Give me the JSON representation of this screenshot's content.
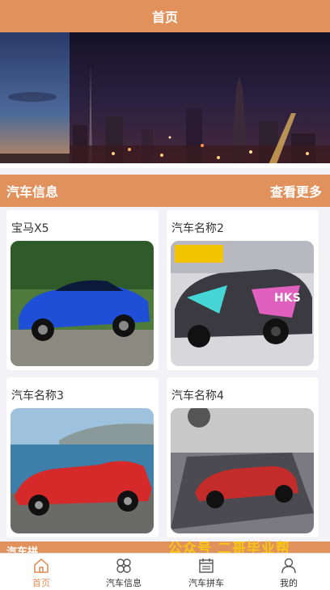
{
  "navbar": {
    "title": "首页"
  },
  "section": {
    "title": "汽车信息",
    "more_label": "查看更多"
  },
  "cars": [
    {
      "name": "宝马X5"
    },
    {
      "name": "汽车名称2"
    },
    {
      "name": "汽车名称3"
    },
    {
      "name": "汽车名称4"
    }
  ],
  "next_section": {
    "title": "汽车拼"
  },
  "watermark": {
    "text": "公众号 二哥毕业帮"
  },
  "tabbar": {
    "items": [
      {
        "label": "首页",
        "icon": "home-icon",
        "active": true
      },
      {
        "label": "汽车信息",
        "icon": "clover-icon",
        "active": false
      },
      {
        "label": "汽车拼车",
        "icon": "calendar-icon",
        "active": false
      },
      {
        "label": "我的",
        "icon": "person-icon",
        "active": false
      }
    ]
  },
  "colors": {
    "accent": "#e0915c",
    "watermark": "#f5c518"
  }
}
